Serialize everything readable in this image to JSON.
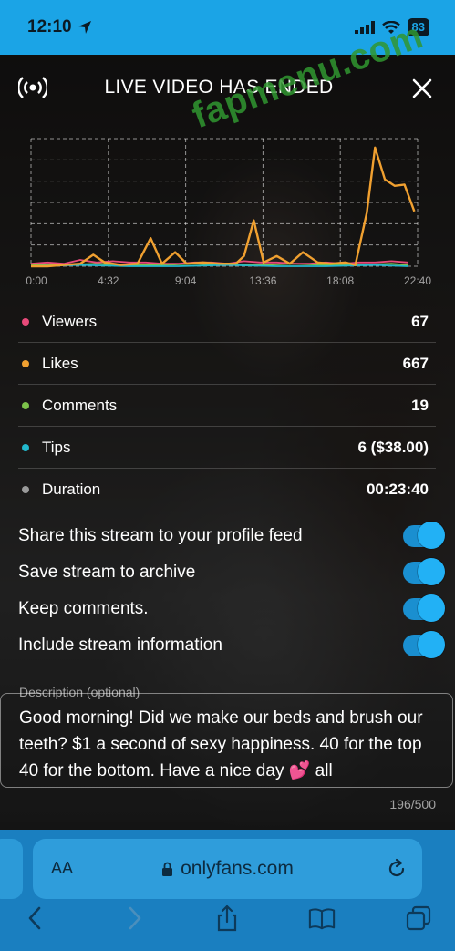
{
  "status_bar": {
    "time": "12:10",
    "battery": "83"
  },
  "header": {
    "title": "LIVE VIDEO HAS ENDED"
  },
  "watermark": "fapmenu.com",
  "chart_data": {
    "type": "line",
    "x_ticks": [
      "0:00",
      "4:32",
      "9:04",
      "13:36",
      "18:08",
      "22:40"
    ],
    "xlim": [
      0,
      23.6
    ],
    "ylim": [
      0,
      10
    ],
    "grid": true,
    "series": [
      {
        "name": "Viewers",
        "color": "#e84a7a",
        "x": [
          0,
          1,
          2,
          3,
          4,
          5,
          6,
          7,
          8,
          9,
          10,
          11,
          12,
          13,
          14,
          15,
          16,
          17,
          18,
          19,
          20,
          21,
          22,
          23
        ],
        "y": [
          0.2,
          0.3,
          0.2,
          0.5,
          0.3,
          0.4,
          0.3,
          0.3,
          0.2,
          0.2,
          0.3,
          0.3,
          0.2,
          0.4,
          0.3,
          0.3,
          0.2,
          0.2,
          0.3,
          0.2,
          0.3,
          0.3,
          0.4,
          0.3
        ]
      },
      {
        "name": "Likes",
        "color": "#f0a030",
        "x": [
          0,
          1,
          2,
          3,
          3.8,
          4.5,
          5.5,
          6.5,
          7.3,
          8,
          8.8,
          9.5,
          10.5,
          11.5,
          12.5,
          13,
          13.6,
          14.2,
          15,
          15.8,
          16.6,
          17.5,
          18.3,
          19.2,
          19.8,
          20.5,
          21,
          21.6,
          22.2,
          22.8,
          23.4
        ],
        "y": [
          0,
          0,
          0.1,
          0.2,
          0.9,
          0.3,
          0.1,
          0.2,
          2.2,
          0.2,
          1.1,
          0.2,
          0.3,
          0.2,
          0.2,
          0.8,
          3.6,
          0.3,
          0.8,
          0.2,
          1.1,
          0.3,
          0.2,
          0.3,
          0.1,
          4.2,
          9.3,
          6.8,
          6.3,
          6.4,
          4.3
        ]
      },
      {
        "name": "Comments",
        "color": "#7cc24a",
        "x": [
          0,
          2,
          4,
          6,
          8,
          10,
          12,
          14,
          16,
          18,
          20,
          22,
          23
        ],
        "y": [
          0.1,
          0.1,
          0.2,
          0.1,
          0.1,
          0.2,
          0.1,
          0.1,
          0.2,
          0.1,
          0.1,
          0.2,
          0.1
        ]
      },
      {
        "name": "Tips",
        "color": "#22b8cc",
        "x": [
          0,
          3,
          6,
          9,
          12,
          15,
          18,
          21,
          23
        ],
        "y": [
          0,
          0.1,
          0,
          0,
          0.1,
          0,
          0,
          0.1,
          0
        ]
      }
    ]
  },
  "stats": [
    {
      "label": "Viewers",
      "value": "67",
      "color": "#e84a7a"
    },
    {
      "label": "Likes",
      "value": "667",
      "color": "#f0a030"
    },
    {
      "label": "Comments",
      "value": "19",
      "color": "#7cc24a"
    },
    {
      "label": "Tips",
      "value": "6 ($38.00)",
      "color": "#22b8cc"
    },
    {
      "label": "Duration",
      "value": "00:23:40",
      "color": "#9a9a9a"
    }
  ],
  "toggles": [
    {
      "label": "Share this stream to your profile feed",
      "on": true
    },
    {
      "label": "Save stream to archive",
      "on": true
    },
    {
      "label": "Keep comments.",
      "on": true
    },
    {
      "label": "Include stream information",
      "on": true
    }
  ],
  "description": {
    "label": "Description (optional)",
    "text": "Good morning! Did we make our beds and brush our teeth? $1 a second of sexy happiness. 40 for the top 40 for the bottom. Have a nice day 💕 all",
    "char_count": "196/500"
  },
  "browser": {
    "aa_label": "AA",
    "url": "onlyfans.com"
  }
}
